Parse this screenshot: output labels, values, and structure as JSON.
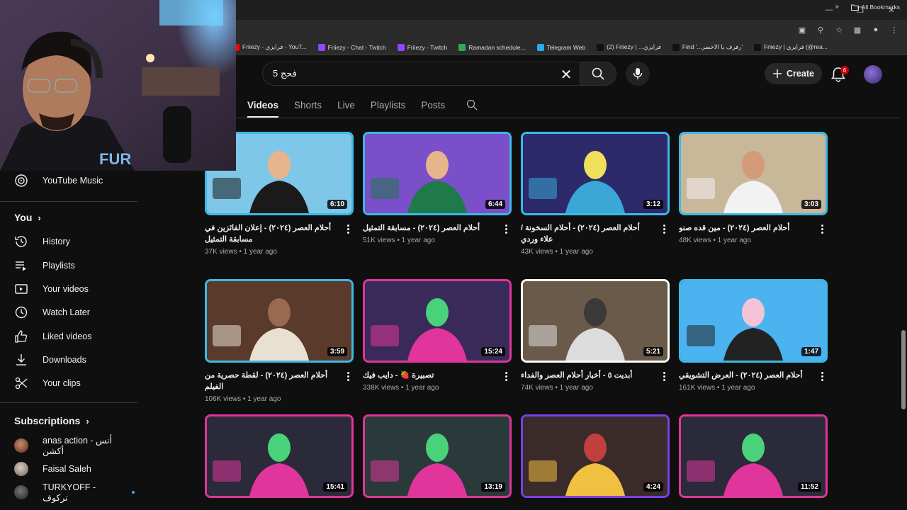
{
  "browser": {
    "bookmarks": [
      {
        "label": "Friiezy - فرايزي - YouT...",
        "color": "#ff0000"
      },
      {
        "label": "Friiezy - Chat - Twitch",
        "color": "#9146ff"
      },
      {
        "label": "Friiezy - Twitch",
        "color": "#9146ff"
      },
      {
        "label": "Ramadan schedule...",
        "color": "#34a853"
      },
      {
        "label": "Telegram Web",
        "color": "#2aabee"
      },
      {
        "label": "(2) Friiezy | ...فرايزي",
        "color": "#111111"
      },
      {
        "label": "Find '...رفرف يا الاخضر'",
        "color": "#111111"
      },
      {
        "label": "Friiezy | فرايزي (@rea...",
        "color": "#111111"
      }
    ],
    "all_bookmarks": "All Bookmarks"
  },
  "masthead": {
    "search_value": "فحج 5",
    "create_label": "Create",
    "notification_count": "6"
  },
  "tabs": [
    "Videos",
    "Shorts",
    "Live",
    "Playlists",
    "Posts"
  ],
  "sidebar": {
    "youtube_music": "YouTube Music",
    "you_heading": "You",
    "items": [
      "History",
      "Playlists",
      "Your videos",
      "Watch Later",
      "Liked videos",
      "Downloads",
      "Your clips"
    ],
    "subscriptions_heading": "Subscriptions",
    "subscriptions": [
      "anas action - أنس أكشن",
      "Faisal Saleh",
      "TURKYOFF - تركوف"
    ]
  },
  "videos": [
    {
      "title": "أحلام العصر (٢٠٢٤) - إعلان الفائزين في مسابقة التمثيل",
      "views": "37K views",
      "age": "1 year ago",
      "duration": "6:10"
    },
    {
      "title": "أحلام العصر (٢٠٢٤) - مسابقة التمثيل",
      "views": "51K views",
      "age": "1 year ago",
      "duration": "6:44"
    },
    {
      "title": "أحلام العصر (٢٠٢٤) - أحلام السخونة / علاء وردي",
      "views": "43K views",
      "age": "1 year ago",
      "duration": "3:12"
    },
    {
      "title": "أحلام العصر (٢٠٢٤) - مين قده صنو",
      "views": "48K views",
      "age": "1 year ago",
      "duration": "3:03"
    },
    {
      "title": "أحلام العصر (٢٠٢٤) - لقطة حصرية من الفيلم",
      "views": "106K views",
      "age": "1 year ago",
      "duration": "3:59"
    },
    {
      "title": "تصبيرة 🍓 - دايب فيك",
      "views": "338K views",
      "age": "1 year ago",
      "duration": "15:24"
    },
    {
      "title": "أبديت ٥ - أخبار أحلام العصر والفداء",
      "views": "74K views",
      "age": "1 year ago",
      "duration": "5:21"
    },
    {
      "title": "أحلام العصر (٢٠٢٤) - العرض التشويقي",
      "views": "161K views",
      "age": "1 year ago",
      "duration": "1:47"
    },
    {
      "title": "",
      "views": "",
      "age": "",
      "duration": "15:41"
    },
    {
      "title": "",
      "views": "",
      "age": "",
      "duration": "13:19"
    },
    {
      "title": "",
      "views": "",
      "age": "",
      "duration": "4:24"
    },
    {
      "title": "",
      "views": "",
      "age": "",
      "duration": "11:52"
    }
  ],
  "colors": {
    "thumb_border_blue": "#3cb9e6",
    "thumb_border_pink": "#e0359a",
    "thumb_border_white": "#ffffff",
    "thumb_border_purple": "#7b3fe4"
  }
}
